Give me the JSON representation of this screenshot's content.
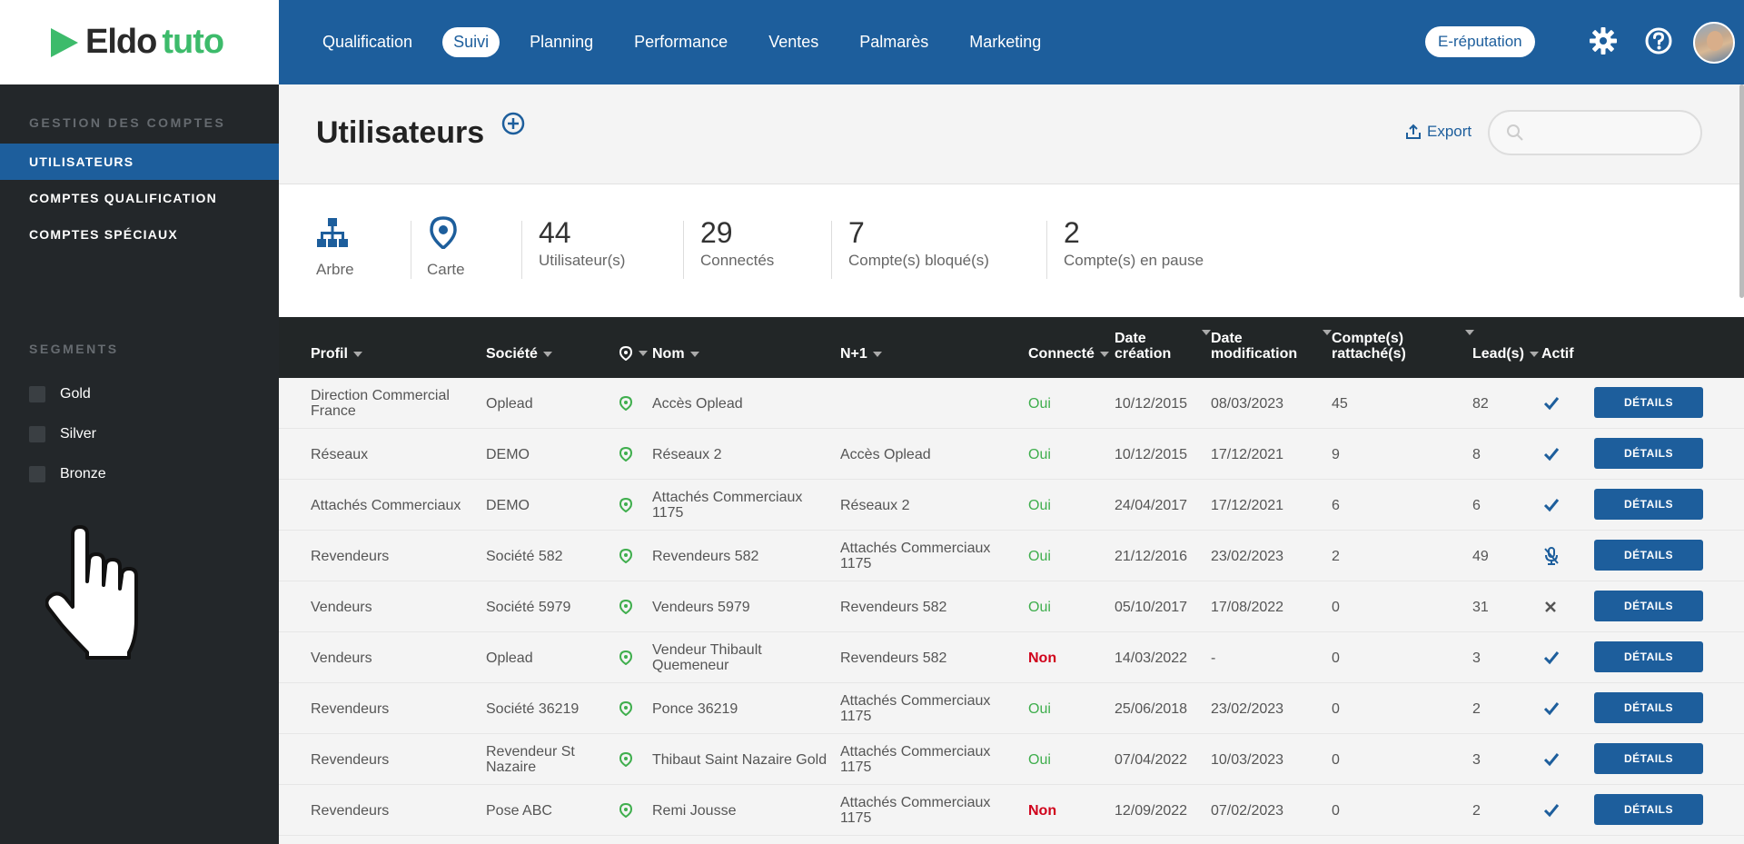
{
  "brand": {
    "part1": "Eldo",
    "part2": "tuto",
    "accent": "#3dbb6b"
  },
  "sidebar": {
    "section_title": "GESTION DES COMPTES",
    "items": [
      {
        "label": "UTILISATEURS",
        "active": true
      },
      {
        "label": "COMPTES QUALIFICATION",
        "active": false
      },
      {
        "label": "COMPTES SPÉCIAUX",
        "active": false
      }
    ],
    "segments_title": "SEGMENTS",
    "segments": [
      {
        "label": "Gold"
      },
      {
        "label": "Silver"
      },
      {
        "label": "Bronze"
      }
    ]
  },
  "topnav": {
    "items": [
      "Qualification",
      "Suivi",
      "Planning",
      "Performance",
      "Ventes",
      "Palmarès",
      "Marketing"
    ],
    "active": "Suivi",
    "ereputation": "E-réputation"
  },
  "header": {
    "title": "Utilisateurs",
    "export_label": "Export",
    "search_placeholder": ""
  },
  "stats": {
    "arbre_label": "Arbre",
    "carte_label": "Carte",
    "users": {
      "value": "44",
      "label": "Utilisateur(s)"
    },
    "connected": {
      "value": "29",
      "label": "Connectés"
    },
    "blocked": {
      "value": "7",
      "label": "Compte(s) bloqué(s)"
    },
    "paused": {
      "value": "2",
      "label": "Compte(s) en pause"
    }
  },
  "table": {
    "headers": {
      "profil": "Profil",
      "societe": "Société",
      "nom": "Nom",
      "n1": "N+1",
      "connecte": "Connecté",
      "date_creation_1": "Date",
      "date_creation_2": "création",
      "date_modif_1": "Date",
      "date_modif_2": "modification",
      "comptes_1": "Compte(s)",
      "comptes_2": "rattaché(s)",
      "leads": "Lead(s)",
      "actif": "Actif"
    },
    "details_label": "DÉTAILS",
    "rows": [
      {
        "profil": "Direction Commercial France",
        "societe": "Oplead",
        "nom": "Accès Oplead",
        "n1": "",
        "connecte": "Oui",
        "creation": "10/12/2015",
        "modification": "08/03/2023",
        "comptes": "45",
        "leads": "82",
        "actif": "check"
      },
      {
        "profil": "Réseaux",
        "societe": "DEMO",
        "nom": "Réseaux 2",
        "n1": "Accès Oplead",
        "connecte": "Oui",
        "creation": "10/12/2015",
        "modification": "17/12/2021",
        "comptes": "9",
        "leads": "8",
        "actif": "check"
      },
      {
        "profil": "Attachés Commerciaux",
        "societe": "DEMO",
        "nom": "Attachés Commerciaux 1175",
        "n1": "Réseaux 2",
        "connecte": "Oui",
        "creation": "24/04/2017",
        "modification": "17/12/2021",
        "comptes": "6",
        "leads": "6",
        "actif": "check"
      },
      {
        "profil": "Revendeurs",
        "societe": "Société 582",
        "nom": "Revendeurs 582",
        "n1": "Attachés Commerciaux 1175",
        "connecte": "Oui",
        "creation": "21/12/2016",
        "modification": "23/02/2023",
        "comptes": "2",
        "leads": "49",
        "actif": "pause"
      },
      {
        "profil": "Vendeurs",
        "societe": "Société 5979",
        "nom": "Vendeurs 5979",
        "n1": "Revendeurs 582",
        "connecte": "Oui",
        "creation": "05/10/2017",
        "modification": "17/08/2022",
        "comptes": "0",
        "leads": "31",
        "actif": "cross"
      },
      {
        "profil": "Vendeurs",
        "societe": "Oplead",
        "nom": "Vendeur Thibault Quemeneur",
        "n1": "Revendeurs 582",
        "connecte": "Non",
        "creation": "14/03/2022",
        "modification": "-",
        "comptes": "0",
        "leads": "3",
        "actif": "check"
      },
      {
        "profil": "Revendeurs",
        "societe": "Société 36219",
        "nom": "Ponce 36219",
        "n1": "Attachés Commerciaux 1175",
        "connecte": "Oui",
        "creation": "25/06/2018",
        "modification": "23/02/2023",
        "comptes": "0",
        "leads": "2",
        "actif": "check"
      },
      {
        "profil": "Revendeurs",
        "societe": "Revendeur St Nazaire",
        "nom": "Thibaut Saint Nazaire Gold",
        "n1": "Attachés Commerciaux 1175",
        "connecte": "Oui",
        "creation": "07/04/2022",
        "modification": "10/03/2023",
        "comptes": "0",
        "leads": "3",
        "actif": "check"
      },
      {
        "profil": "Revendeurs",
        "societe": "Pose ABC",
        "nom": "Remi Jousse",
        "n1": "Attachés Commerciaux 1175",
        "connecte": "Non",
        "creation": "12/09/2022",
        "modification": "07/02/2023",
        "comptes": "0",
        "leads": "2",
        "actif": "check"
      }
    ]
  },
  "colors": {
    "primary": "#1d5e9c",
    "oui": "#3fae4d",
    "non": "#d0021b",
    "sidebar": "#23272a"
  }
}
